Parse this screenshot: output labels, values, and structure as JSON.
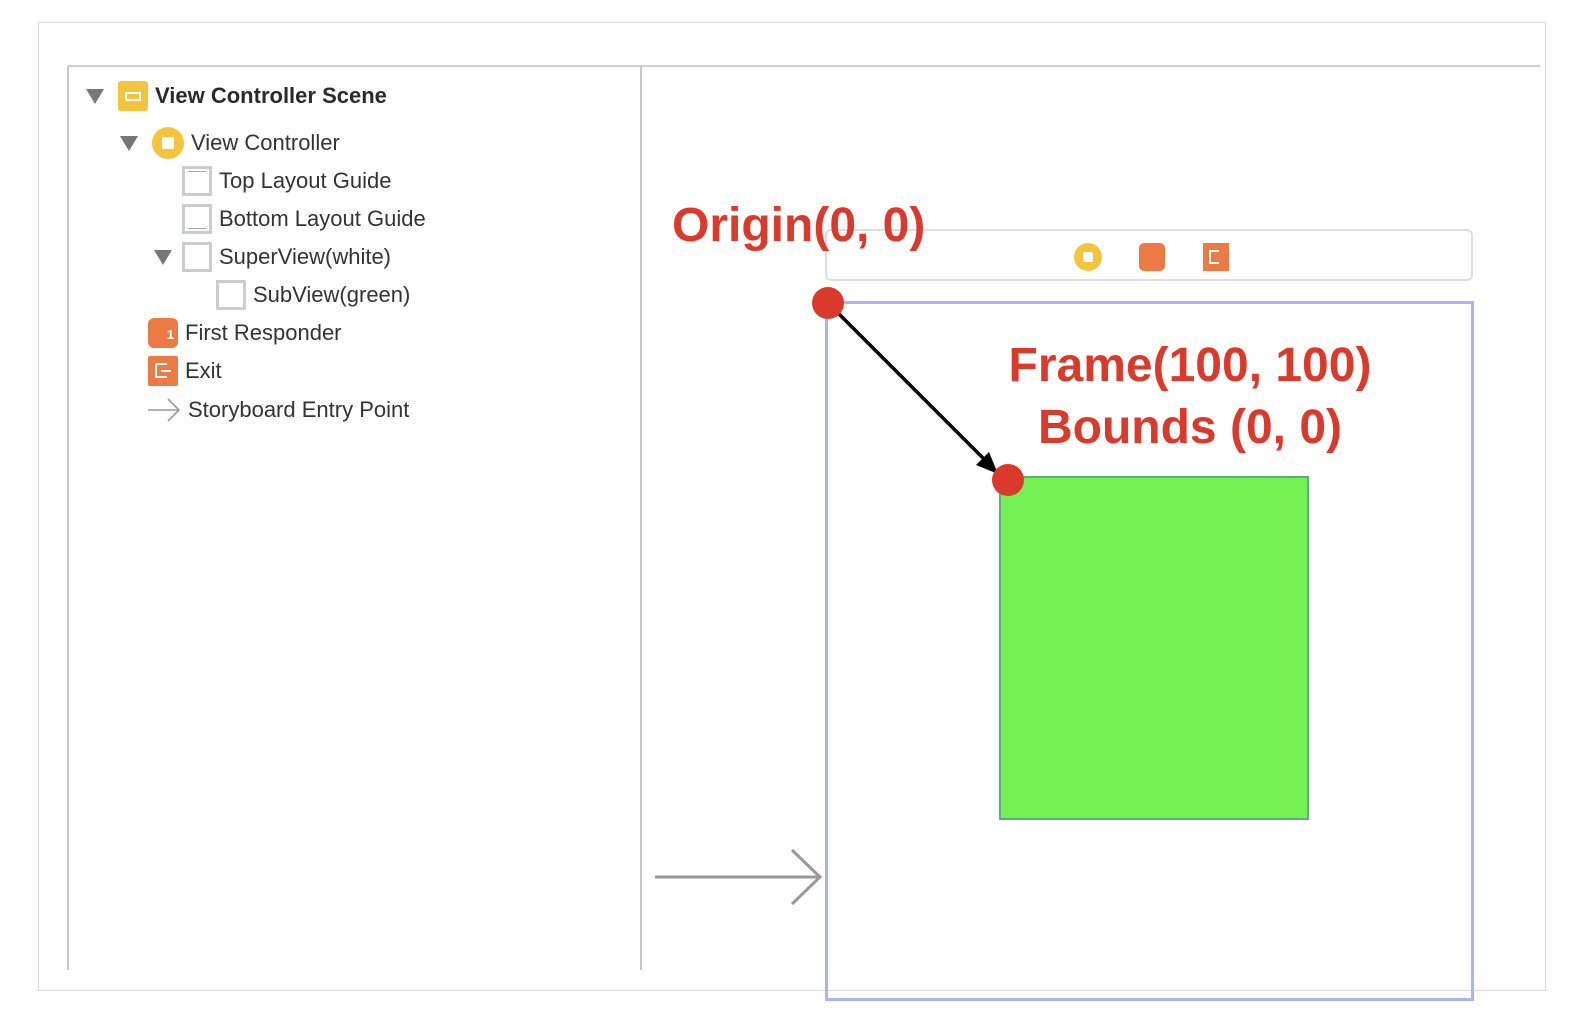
{
  "outline": {
    "scene": "View Controller Scene",
    "view_controller": "View Controller",
    "top_layout_guide": "Top Layout Guide",
    "bottom_layout_guide": "Bottom Layout Guide",
    "superview": "SuperView(white)",
    "subview": "SubView(green)",
    "first_responder": "First Responder",
    "exit": "Exit",
    "entry_point": "Storyboard Entry Point"
  },
  "annotations": {
    "origin": "Origin(0, 0)",
    "frame": "Frame(100, 100)",
    "bounds": "Bounds (0, 0)"
  },
  "colors": {
    "annotation_red": "#da3a2c",
    "subview_green": "#76f154",
    "superview_border": "#aab4f0",
    "vc_yellow": "#f2c53d",
    "orange": "#ec7a45"
  }
}
